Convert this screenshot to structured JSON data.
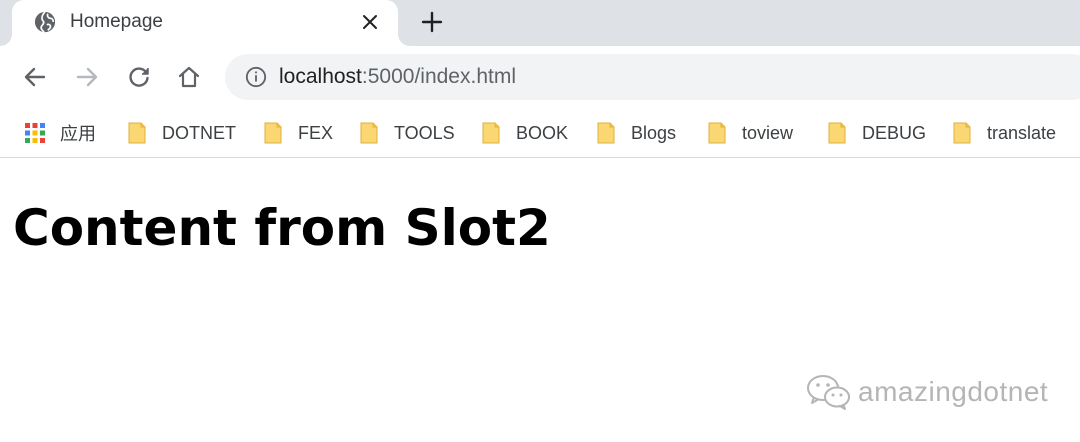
{
  "tab": {
    "title": "Homepage",
    "favicon": "globe-icon",
    "close": "close-icon",
    "new_tab": "plus-icon"
  },
  "toolbar": {
    "back": "back-arrow-icon",
    "forward": "forward-arrow-icon",
    "reload": "reload-icon",
    "home": "home-icon",
    "url_host": "localhost",
    "url_rest": ":5000/index.html",
    "site_info": "info-icon"
  },
  "bookmarks": {
    "apps_label": "应用",
    "items": [
      {
        "label": "DOTNET",
        "icon": "folder-icon"
      },
      {
        "label": "FEX",
        "icon": "folder-icon"
      },
      {
        "label": "TOOLS",
        "icon": "folder-icon"
      },
      {
        "label": "BOOK",
        "icon": "folder-icon"
      },
      {
        "label": "Blogs",
        "icon": "folder-icon"
      },
      {
        "label": "toview",
        "icon": "folder-icon"
      },
      {
        "label": "DEBUG",
        "icon": "folder-icon"
      },
      {
        "label": "translate",
        "icon": "folder-icon"
      }
    ]
  },
  "page": {
    "heading": "Content from Slot2"
  },
  "watermark": {
    "text": "amazingdotnet",
    "icon": "wechat-icon"
  },
  "colors": {
    "tabstrip": "#dee1e6",
    "omnibox": "#f1f3f4",
    "folder": "#fbd774",
    "watermark": "#b5b5b5"
  }
}
